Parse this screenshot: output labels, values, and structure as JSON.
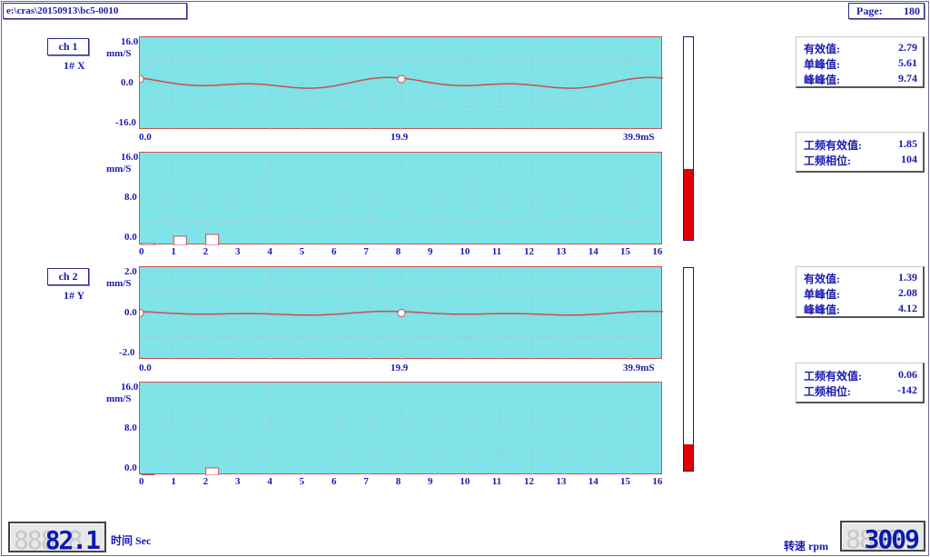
{
  "header": {
    "path": "e:\\cras\\20150913\\bc5-0010",
    "page_label": "Page:",
    "page_number": "180"
  },
  "channels": [
    {
      "name": "ch 1",
      "sensor": "1# X",
      "wave": {
        "y_top": "16.0",
        "y_unit": "mm/S",
        "y_mid": "0.0",
        "y_bottom": "-16.0",
        "x_start": "0.0",
        "x_mid": "19.9",
        "x_end": "39.9mS"
      },
      "spectrum": {
        "y_top": "16.0",
        "y_unit": "mm/S",
        "y_mid": "8.0",
        "y_bottom": "0.0",
        "x_ticks": [
          "0",
          "1",
          "2",
          "3",
          "4",
          "5",
          "6",
          "7",
          "8",
          "9",
          "10",
          "11",
          "12",
          "13",
          "14",
          "15",
          "16"
        ]
      },
      "meter_level": 0.35,
      "stats": [
        {
          "label": "有效值:",
          "value": "2.79"
        },
        {
          "label": "单峰值:",
          "value": "5.61"
        },
        {
          "label": "峰峰值:",
          "value": "9.74"
        }
      ],
      "power": [
        {
          "label": "工频有效值:",
          "value": "1.85"
        },
        {
          "label": "工频相位:",
          "value": "104"
        }
      ]
    },
    {
      "name": "ch 2",
      "sensor": "1# Y",
      "wave": {
        "y_top": "2.0",
        "y_unit": "mm/S",
        "y_mid": "0.0",
        "y_bottom": "-2.0",
        "x_start": "0.0",
        "x_mid": "19.9",
        "x_end": "39.9mS"
      },
      "spectrum": {
        "y_top": "16.0",
        "y_unit": "mm/S",
        "y_mid": "8.0",
        "y_bottom": "0.0",
        "x_ticks": [
          "0",
          "1",
          "2",
          "3",
          "4",
          "5",
          "6",
          "7",
          "8",
          "9",
          "10",
          "11",
          "12",
          "13",
          "14",
          "15",
          "16"
        ]
      },
      "meter_level": 0.13,
      "stats": [
        {
          "label": "有效值:",
          "value": "1.39"
        },
        {
          "label": "单峰值:",
          "value": "2.08"
        },
        {
          "label": "峰峰值:",
          "value": "4.12"
        }
      ],
      "power": [
        {
          "label": "工频有效值:",
          "value": "0.06"
        },
        {
          "label": "工频相位:",
          "value": "-142"
        }
      ]
    }
  ],
  "footer": {
    "time_value": "82.1",
    "time_ghost": "888.8",
    "time_label": "时间 Sec",
    "speed_label": "转速 rpm",
    "speed_value": "3009",
    "speed_ghost": "8888"
  },
  "colors": {
    "plot_bg": "#7fe3e8",
    "trace": "#c85050",
    "grid": "#a0c8c8",
    "meter_fill": "#e00000"
  }
}
